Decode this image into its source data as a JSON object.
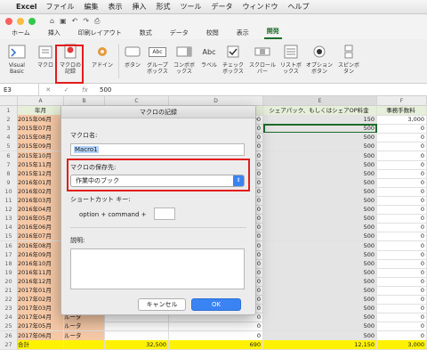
{
  "menubar": {
    "app": "Excel",
    "items": [
      "ファイル",
      "編集",
      "表示",
      "挿入",
      "形式",
      "ツール",
      "データ",
      "ウィンドウ",
      "ヘルプ"
    ]
  },
  "tabs": [
    "ホーム",
    "挿入",
    "印刷レイアウト",
    "数式",
    "データ",
    "校閲",
    "表示",
    "開発"
  ],
  "active_tab": "開発",
  "ribbon": {
    "visual_basic": "Visual Basic",
    "macro": "マクロ",
    "record_macro": "マクロの記録",
    "addin": "アドイン",
    "button": "ボタン",
    "groupbox": "グループボックス",
    "combobox": "コンボボックス",
    "label": "ラベル",
    "checkbox": "チェックボックス",
    "scrollbar": "スクロールバー",
    "listbox": "リストボックス",
    "option": "オプションボタン",
    "spin": "スピンボタン",
    "abc": "Abc"
  },
  "formula_bar": {
    "cell": "E3",
    "fx": "fx",
    "value": "500"
  },
  "columns": [
    "A",
    "B",
    "C",
    "D",
    "E",
    "F"
  ],
  "headers": {
    "a": "年月",
    "d_tail": "ー)",
    "e": "シェアパック、もしくはシェアOP料金",
    "f": "事務手数料"
  },
  "rows": [
    {
      "n": "1"
    },
    {
      "n": "2",
      "a": "2015年06月",
      "d": "690",
      "e": "150",
      "f": "3,000"
    },
    {
      "n": "3",
      "a": "2015年07月",
      "d": "0",
      "e": "500",
      "f": "0"
    },
    {
      "n": "4",
      "a": "2015年08月",
      "d": "0",
      "e": "500",
      "f": "0"
    },
    {
      "n": "5",
      "a": "2015年09月",
      "d": "0",
      "e": "500",
      "f": "0"
    },
    {
      "n": "6",
      "a": "2015年10月",
      "d": "0",
      "e": "500",
      "f": "0"
    },
    {
      "n": "7",
      "a": "2015年11月",
      "d": "0",
      "e": "500",
      "f": "0"
    },
    {
      "n": "8",
      "a": "2015年12月",
      "d": "0",
      "e": "500",
      "f": "0"
    },
    {
      "n": "9",
      "a": "2016年01月",
      "d": "0",
      "e": "500",
      "f": "0"
    },
    {
      "n": "10",
      "a": "2016年02月",
      "d": "0",
      "e": "500",
      "f": "0"
    },
    {
      "n": "11",
      "a": "2016年03月",
      "d": "0",
      "e": "500",
      "f": "0"
    },
    {
      "n": "12",
      "a": "2016年04月",
      "d": "0",
      "e": "500",
      "f": "0"
    },
    {
      "n": "13",
      "a": "2016年05月",
      "d": "0",
      "e": "500",
      "f": "0"
    },
    {
      "n": "14",
      "a": "2016年06月",
      "d": "0",
      "e": "500",
      "f": "0"
    },
    {
      "n": "15",
      "a": "2016年07月",
      "d": "0",
      "e": "500",
      "f": "0"
    },
    {
      "n": "16",
      "a": "2016年08月",
      "d": "0",
      "e": "500",
      "f": "0"
    },
    {
      "n": "17",
      "a": "2016年09月",
      "d": "0",
      "e": "500",
      "f": "0"
    },
    {
      "n": "18",
      "a": "2016年10月",
      "d": "0",
      "e": "500",
      "f": "0"
    },
    {
      "n": "19",
      "a": "2016年11月",
      "d": "0",
      "e": "500",
      "f": "0"
    },
    {
      "n": "20",
      "a": "2016年12月",
      "d": "0",
      "e": "500",
      "f": "0"
    },
    {
      "n": "21",
      "a": "2017年01月",
      "d": "0",
      "e": "500",
      "f": "0"
    },
    {
      "n": "22",
      "a": "2017年02月",
      "d": "0",
      "e": "500",
      "f": "0"
    },
    {
      "n": "23",
      "a": "2017年03月",
      "d": "0",
      "e": "500",
      "f": "0"
    },
    {
      "n": "24",
      "a": "2017年04月",
      "b": "ルータ",
      "d": "0",
      "e": "500",
      "f": "0"
    },
    {
      "n": "25",
      "a": "2017年05月",
      "b": "ルータ",
      "d": "0",
      "e": "500",
      "f": "0"
    },
    {
      "n": "26",
      "a": "2017年06月",
      "b": "ルータ",
      "d": "0",
      "e": "500",
      "f": "0"
    },
    {
      "n": "27",
      "a": "合計",
      "c": "32,500",
      "d": "690",
      "e": "12,150",
      "f": "3,000"
    }
  ],
  "dialog": {
    "title": "マクロの記録",
    "name_label": "マクロ名:",
    "name_value": "Macro1",
    "store_label": "マクロの保存先:",
    "store_value": "作業中のブック",
    "shortcut_label": "ショートカット キー:",
    "shortcut_prefix": "option + command +",
    "desc_label": "説明:",
    "cancel": "キャンセル",
    "ok": "OK"
  },
  "colors": {
    "accent": "#1d6b2c",
    "highlight": "#e31c1c",
    "ok_button": "#3a83f2",
    "total_row": "#fff200"
  }
}
